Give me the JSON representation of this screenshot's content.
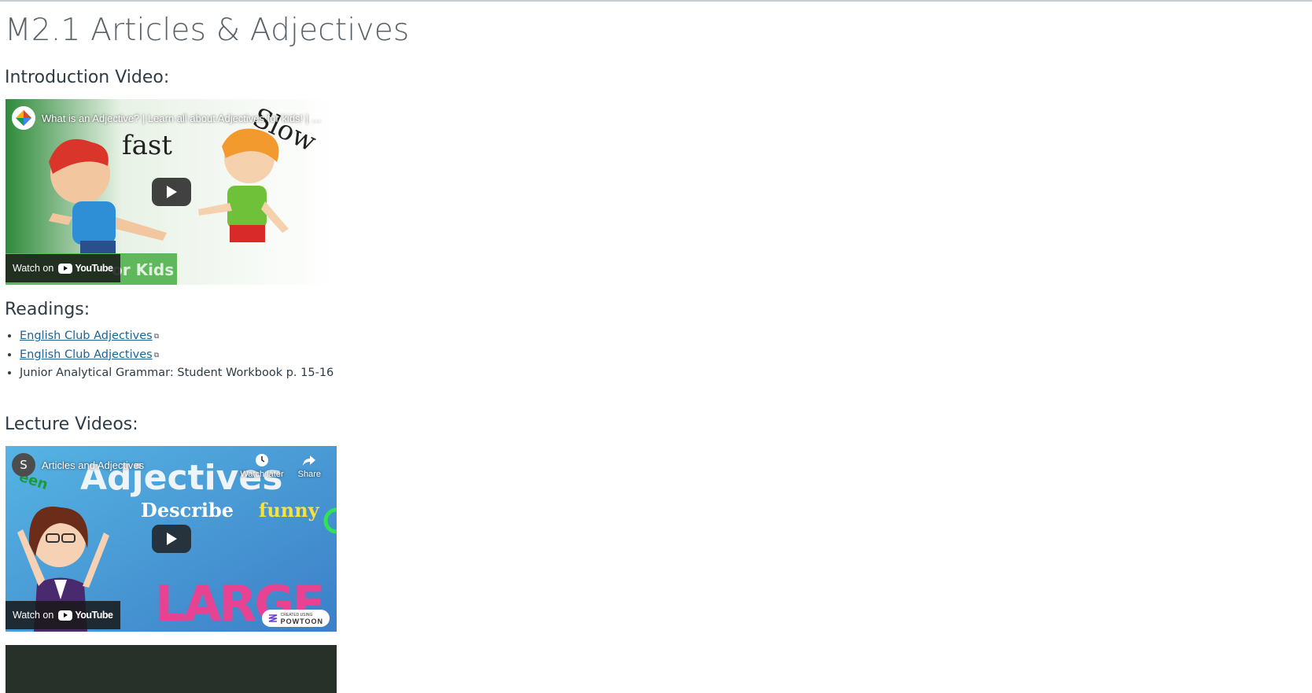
{
  "page": {
    "title": "M2.1 Articles & Adjectives"
  },
  "sections": {
    "intro_heading": "Introduction Video:",
    "readings_heading": "Readings:",
    "lectures_heading": "Lecture Videos:"
  },
  "intro_video": {
    "title": "What is an Adjective? | Learn all about Adjectives for kids! | …",
    "watch_on": "Watch on",
    "brand": "YouTube",
    "thumb_text_fast": "fast",
    "thumb_text_slow": "Slow",
    "thumb_text_kids": "or Kids"
  },
  "readings": [
    {
      "label": "English Club Adjectives",
      "link": true
    },
    {
      "label": "English Club Adjectives",
      "link": true
    },
    {
      "label": "Junior Analytical Grammar: Student Workbook p. 15-16",
      "link": false
    }
  ],
  "lecture_video": {
    "channel_initial": "S",
    "title": "Articles and Adjectives",
    "watch_later": "Watch later",
    "share": "Share",
    "watch_on": "Watch on",
    "brand": "YouTube",
    "thumb_word_1": "Adjectives",
    "thumb_word_2": "Describe",
    "thumb_word_3": "funny",
    "thumb_word_4": "LARGE",
    "thumb_word_5": "een",
    "badge_small": "CREATED USING",
    "badge": "POWTOON"
  },
  "colors": {
    "link": "#1a6496",
    "text": "#2d3b45",
    "title": "#5a6268"
  }
}
